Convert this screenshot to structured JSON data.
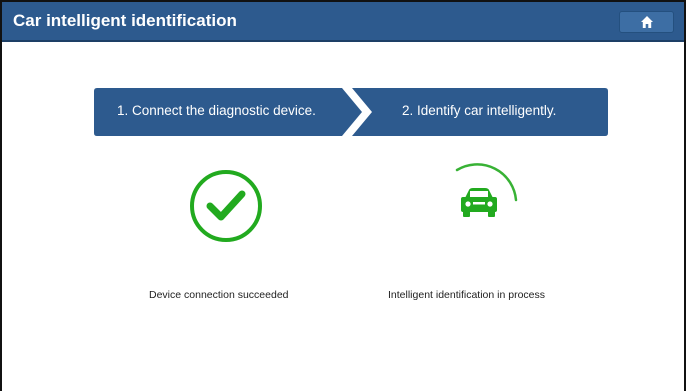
{
  "header": {
    "title": "Car intelligent identification",
    "home_icon": "home-icon"
  },
  "steps": [
    {
      "label": "1. Connect the diagnostic device."
    },
    {
      "label": "2. Identify car intelligently."
    }
  ],
  "status": {
    "connection": {
      "icon": "check-circle-icon",
      "text": "Device connection succeeded",
      "state": "success"
    },
    "identification": {
      "icon": "car-icon",
      "text": "Intelligent identification in process",
      "state": "in-progress"
    }
  },
  "colors": {
    "header_bg": "#2d5a8e",
    "step_bg": "#2d5a8e",
    "success_green": "#22aa1f"
  }
}
